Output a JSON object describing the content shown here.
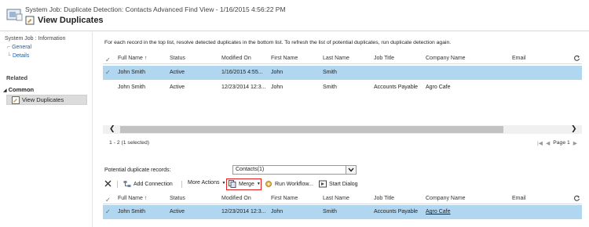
{
  "header": {
    "subtitle": "System Job: Duplicate Detection: Contacts Advanced Find View - 1/16/2015 4:56:22 PM",
    "title": "View Duplicates"
  },
  "sidebar": {
    "section_label": "System Job : Information",
    "links": [
      "General",
      "Details"
    ],
    "related_label": "Related",
    "common_label": "Common",
    "selected_item": "View Duplicates"
  },
  "main": {
    "instructions": "For each record in the top list, resolve detected duplicates in the bottom list. To refresh the list of potential duplicates, run duplicate detection again.",
    "columns": [
      "Full Name ↑",
      "Status",
      "Modified On",
      "First Name",
      "Last Name",
      "Job Title",
      "Company Name",
      "Email"
    ],
    "top_rows": [
      {
        "full_name": "John Smith",
        "status": "Active",
        "modified_on": "1/16/2015 4:55...",
        "first_name": "John",
        "last_name": "Smith",
        "job_title": "",
        "company": "",
        "email": "",
        "selected": true
      },
      {
        "full_name": "John Smith",
        "status": "Active",
        "modified_on": "12/23/2014 12:3...",
        "first_name": "John",
        "last_name": "Smith",
        "job_title": "Accounts Payable",
        "company": "Agro Cafe",
        "email": "",
        "selected": false
      }
    ],
    "status_text": "1 - 2 (1 selected)",
    "pager_text": "Page 1",
    "potential_label": "Potential duplicate records:",
    "entity_select_value": "Contacts(1)",
    "toolbar": {
      "add_connection": "Add Connection",
      "more_actions": "More Actions",
      "merge": "Merge",
      "run_workflow": "Run Workflow...",
      "start_dialog": "Start Dialog"
    },
    "bottom_rows": [
      {
        "full_name": "John Smith",
        "status": "Active",
        "modified_on": "12/23/2014 12:3...",
        "first_name": "John",
        "last_name": "Smith",
        "job_title": "Accounts Payable",
        "company": "Agro Cafe",
        "email": "",
        "selected": true
      }
    ]
  },
  "colors": {
    "selected_row": "#b1d6f0",
    "link": "#1160b7",
    "highlight_box": "#e02020"
  }
}
